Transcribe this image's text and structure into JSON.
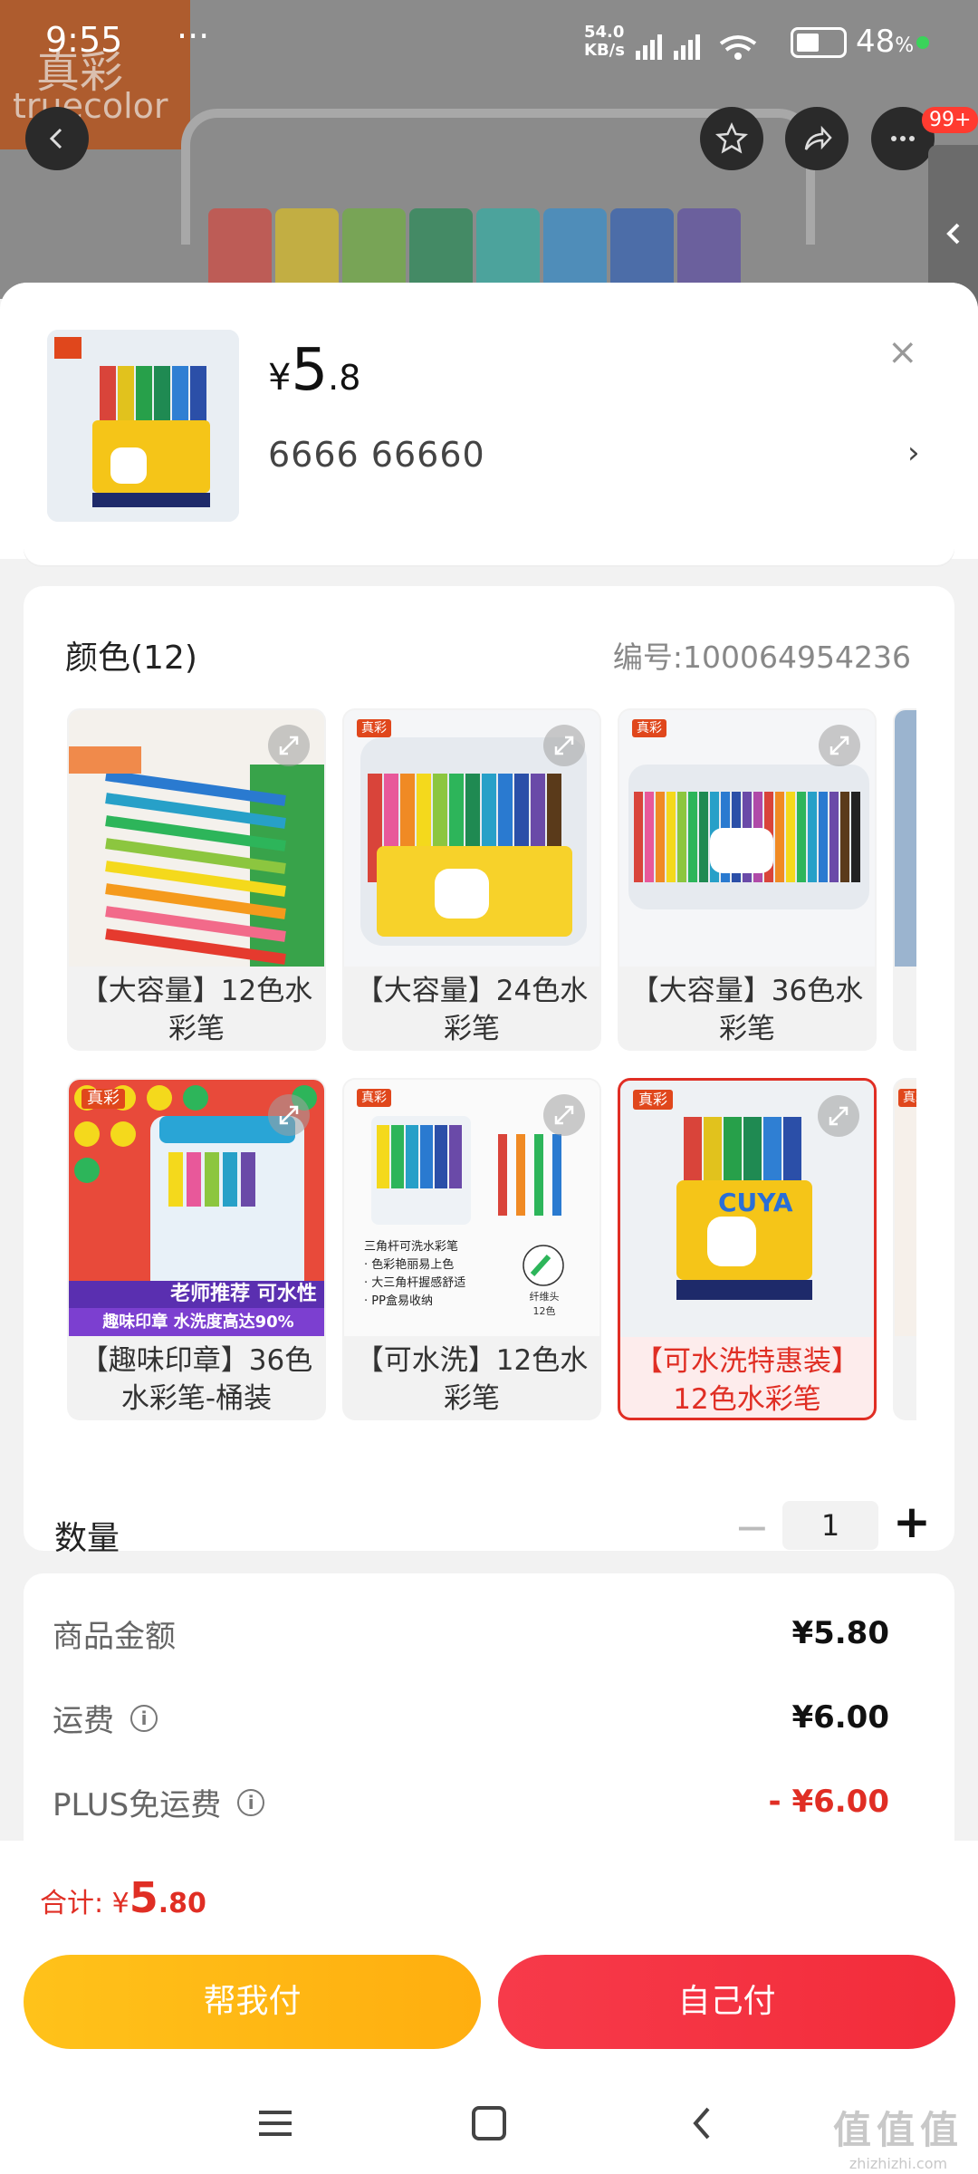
{
  "status_bar": {
    "time": "9:55",
    "dots": "···",
    "speed_top": "54.0",
    "speed_bottom": "KB/s",
    "battery": "48",
    "battery_unit": "%"
  },
  "background": {
    "brand_cn": "真彩",
    "brand_en": "truecolor",
    "notif_badge": "99+"
  },
  "sheet": {
    "price_currency": "¥",
    "price_int": "5",
    "price_dec": ".8",
    "address": "6666  66660",
    "address_arrow": "›",
    "close": "×"
  },
  "color_section": {
    "title": "颜色(12)",
    "code": "编号:100064954236",
    "options": [
      {
        "label": "【大容量】12色水彩笔",
        "selected": false
      },
      {
        "label": "【大容量】24色水彩笔",
        "selected": false
      },
      {
        "label": "【大容量】36色水彩笔",
        "selected": false
      },
      {
        "label": "【趣味印章】36色水彩笔-桶装",
        "selected": false
      },
      {
        "label": "【可水洗】12色水彩笔",
        "selected": false
      },
      {
        "label": "【可水洗特惠装】12色水彩笔",
        "selected": true
      }
    ],
    "thumb_text": {
      "brand": "真彩",
      "brand_en": "truecolor",
      "cuya": "CUYA",
      "promo1": "老师推荐 可水性",
      "promo2": "趣味印章 水洗度高达90%",
      "feat_title": "三角杆可洗水彩笔",
      "feat1": "· 色彩艳丽易上色",
      "feat2": "· 大三角杆握感舒适",
      "feat3": "· PP盒易收纳",
      "feat_tip": "纤维头",
      "feat_count": "12色"
    }
  },
  "quantity": {
    "label": "数量",
    "minus": "−",
    "value": "1",
    "plus": "+"
  },
  "summary": {
    "rows": [
      {
        "label": "商品金额",
        "value": "¥5.80",
        "info": false
      },
      {
        "label": "运费",
        "value": "¥6.00",
        "info": true
      },
      {
        "label": "PLUS免运费",
        "value": "- ¥6.00",
        "info": true
      }
    ]
  },
  "footer": {
    "total_label": "合计: ",
    "total_currency": "¥",
    "total_int": "5",
    "total_dec": ".80",
    "help_pay": "帮我付",
    "self_pay": "自己付"
  },
  "watermark": {
    "cn": "值值值",
    "url": "zhizhizhi.com"
  },
  "colors": {
    "accent_red": "#e02e24",
    "button_yellow": "#ffb814",
    "button_red": "#f4333f"
  }
}
